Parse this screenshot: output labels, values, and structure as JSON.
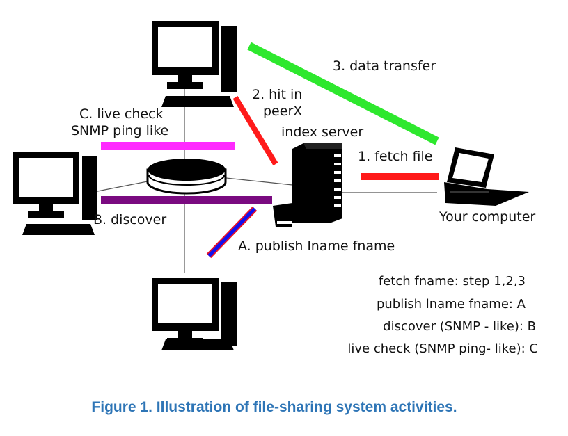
{
  "labels": {
    "data_transfer": "3. data transfer",
    "hit_line1": "2. hit in",
    "hit_line2": "peerX",
    "index_server": "index server",
    "live_check_line1": "C. live check",
    "live_check_line2": "SNMP ping like",
    "fetch_file": "1. fetch file",
    "your_computer": "Your computer",
    "discover": "B. discover",
    "publish": "A. publish lname fname"
  },
  "legend": [
    "fetch fname: step 1,2,3",
    "publish lname fname: A",
    "discover (SNMP - like): B",
    "live check (SNMP ping- like): C"
  ],
  "caption": "Figure 1. Illustration of file-sharing system activities.",
  "colors": {
    "data_transfer": "#2ee82e",
    "hit": "#ff1a1a",
    "fetch": "#ff1a1a",
    "live_check": "#ff2aff",
    "discover": "#7a0a80",
    "publish_fill": "#1010ee",
    "publish_edge": "#e8102a",
    "caption": "#2e75b6",
    "ink": "#000000"
  },
  "icons": [
    "desktop-computer-icon",
    "disk-icon",
    "server-tower-icon",
    "laptop-icon"
  ]
}
